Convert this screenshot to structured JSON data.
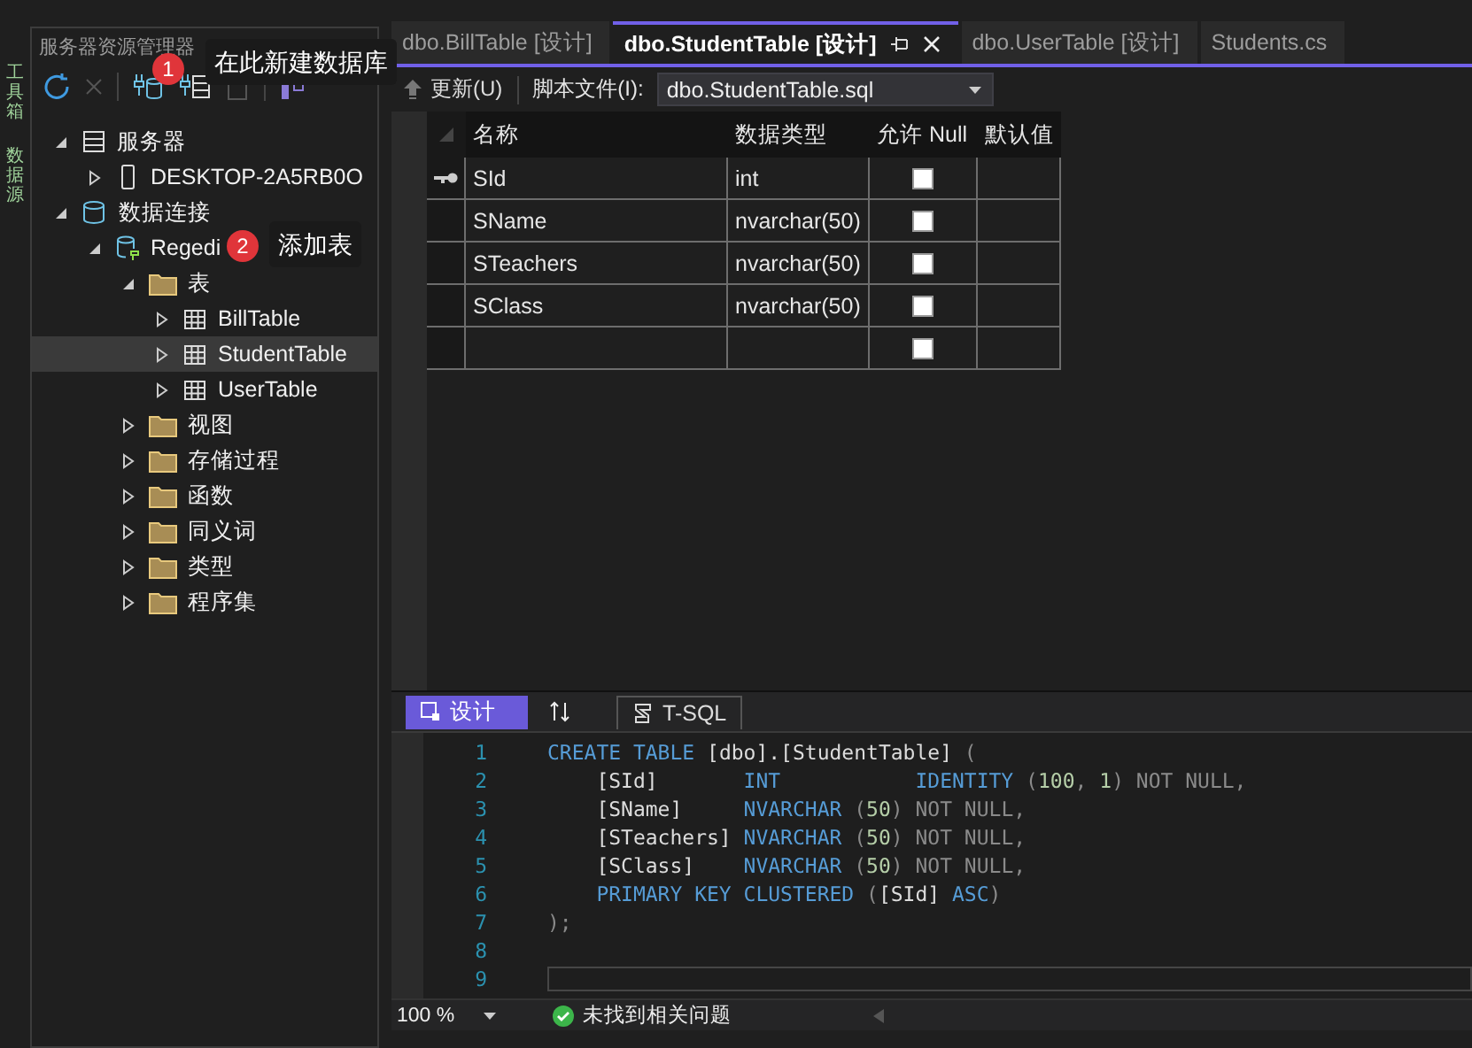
{
  "side_tabs": [
    {
      "label": "工具箱"
    },
    {
      "label": "数据源"
    }
  ],
  "server_explorer": {
    "title": "服务器资源管理器",
    "tree": [
      {
        "label": "服务器",
        "kind": "server",
        "expanded": true,
        "selected": false,
        "children": [
          {
            "label": "DESKTOP-2A5RB0O",
            "kind": "computer",
            "expanded": false,
            "selected": false
          }
        ]
      },
      {
        "label": "数据连接",
        "kind": "database",
        "expanded": true,
        "selected": false,
        "children": [
          {
            "label": "Regedi",
            "kind": "connection",
            "expanded": true,
            "selected": false,
            "children": [
              {
                "label": "表",
                "kind": "folder",
                "expanded": true,
                "selected": false,
                "children": [
                  {
                    "label": "BillTable",
                    "kind": "table",
                    "expanded": false,
                    "selected": false
                  },
                  {
                    "label": "StudentTable",
                    "kind": "table",
                    "expanded": false,
                    "selected": true
                  },
                  {
                    "label": "UserTable",
                    "kind": "table",
                    "expanded": false,
                    "selected": false
                  }
                ]
              },
              {
                "label": "视图",
                "kind": "folder",
                "expanded": false,
                "selected": false
              },
              {
                "label": "存储过程",
                "kind": "folder",
                "expanded": false,
                "selected": false
              },
              {
                "label": "函数",
                "kind": "folder",
                "expanded": false,
                "selected": false
              },
              {
                "label": "同义词",
                "kind": "folder",
                "expanded": false,
                "selected": false
              },
              {
                "label": "类型",
                "kind": "folder",
                "expanded": false,
                "selected": false
              },
              {
                "label": "程序集",
                "kind": "folder",
                "expanded": false,
                "selected": false
              }
            ]
          }
        ]
      }
    ]
  },
  "callouts": [
    {
      "number": "1",
      "text": "在此新建数据库"
    },
    {
      "number": "2",
      "text": "添加表"
    }
  ],
  "document_tabs": [
    {
      "label": "dbo.BillTable [设计]",
      "selected": false
    },
    {
      "label": "dbo.StudentTable [设计]",
      "selected": true
    },
    {
      "label": "dbo.UserTable [设计]",
      "selected": false
    },
    {
      "label": "Students.cs",
      "selected": false
    }
  ],
  "toolbar": {
    "update_button": "更新(U)",
    "script_label": "脚本文件(I):",
    "script_file": "dbo.StudentTable.sql"
  },
  "table": {
    "columns": [
      "名称",
      "数据类型",
      "允许 Null",
      "默认值"
    ],
    "rows": [
      {
        "name": "SId",
        "type": "int",
        "allow_null": false,
        "primary_key": true
      },
      {
        "name": "SName",
        "type": "nvarchar(50)",
        "allow_null": false,
        "primary_key": false
      },
      {
        "name": "STeachers",
        "type": "nvarchar(50)",
        "allow_null": false,
        "primary_key": false
      },
      {
        "name": "SClass",
        "type": "nvarchar(50)",
        "allow_null": false,
        "primary_key": false
      },
      {
        "allow_null": false,
        "primary_key": false
      }
    ]
  },
  "pane_tabs": [
    {
      "label": "设计",
      "kind": "design",
      "selected": true
    },
    {
      "kind": "swap",
      "selected": false
    },
    {
      "label": "T-SQL",
      "kind": "tsql",
      "selected": false
    }
  ],
  "code": [
    {
      "number": "1",
      "current": false,
      "tokens": [
        {
          "text": "CREATE TABLE ",
          "kind": "keyword"
        },
        {
          "text": "[dbo].[StudentTable] ",
          "kind": "plain"
        },
        {
          "text": "(",
          "kind": "gray"
        }
      ]
    },
    {
      "number": "2",
      "current": false,
      "tokens": [
        {
          "text": "    [SId]       ",
          "kind": "plain"
        },
        {
          "text": "INT",
          "kind": "keyword"
        },
        {
          "text": "           IDENTITY",
          "kind": "keyword"
        },
        {
          "text": " (",
          "kind": "gray"
        },
        {
          "text": "100",
          "kind": "number"
        },
        {
          "text": ", ",
          "kind": "gray"
        },
        {
          "text": "1",
          "kind": "number"
        },
        {
          "text": ") NOT NULL,",
          "kind": "gray"
        }
      ]
    },
    {
      "number": "3",
      "current": false,
      "tokens": [
        {
          "text": "    [SName]     ",
          "kind": "plain"
        },
        {
          "text": "NVARCHAR",
          "kind": "keyword"
        },
        {
          "text": " (",
          "kind": "gray"
        },
        {
          "text": "50",
          "kind": "number"
        },
        {
          "text": ") NOT NULL,",
          "kind": "gray"
        }
      ]
    },
    {
      "number": "4",
      "current": false,
      "tokens": [
        {
          "text": "    [STeachers] ",
          "kind": "plain"
        },
        {
          "text": "NVARCHAR",
          "kind": "keyword"
        },
        {
          "text": " (",
          "kind": "gray"
        },
        {
          "text": "50",
          "kind": "number"
        },
        {
          "text": ") NOT NULL,",
          "kind": "gray"
        }
      ]
    },
    {
      "number": "5",
      "current": false,
      "tokens": [
        {
          "text": "    [SClass]    ",
          "kind": "plain"
        },
        {
          "text": "NVARCHAR",
          "kind": "keyword"
        },
        {
          "text": " (",
          "kind": "gray"
        },
        {
          "text": "50",
          "kind": "number"
        },
        {
          "text": ") NOT NULL,",
          "kind": "gray"
        }
      ]
    },
    {
      "number": "6",
      "current": false,
      "tokens": [
        {
          "text": "    PRIMARY KEY CLUSTERED",
          "kind": "keyword"
        },
        {
          "text": " (",
          "kind": "gray"
        },
        {
          "text": "[SId] ",
          "kind": "plain"
        },
        {
          "text": "ASC",
          "kind": "keyword"
        },
        {
          "text": ")",
          "kind": "gray"
        }
      ]
    },
    {
      "number": "7",
      "current": false,
      "tokens": [
        {
          "text": ");",
          "kind": "gray"
        }
      ]
    },
    {
      "number": "8",
      "current": false
    },
    {
      "number": "9",
      "current": true
    }
  ],
  "status_bar": {
    "zoom": "100 %",
    "issues": "未找到相关问题"
  }
}
